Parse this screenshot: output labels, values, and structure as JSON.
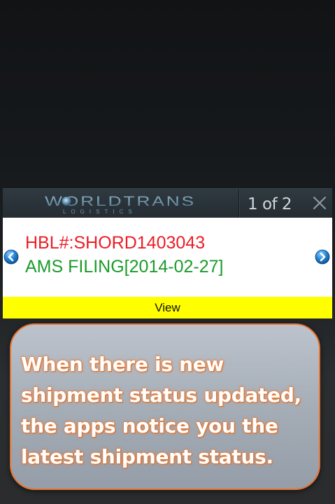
{
  "popup": {
    "logo_text": "WORLDTRANS",
    "logo_subtext": "LOGISTICS",
    "page_indicator": "1 of 2",
    "close_icon": "close-icon",
    "prev_icon": "chevron-left-circle-icon",
    "next_icon": "chevron-right-circle-icon",
    "hbl_text": "HBL#:SHORD1403043",
    "status_text": "AMS FILING[2014-02-27]",
    "view_label": "View"
  },
  "callout": {
    "text": "When there is new\nshipment status updated,\nthe apps notice you the\nlatest shipment status."
  },
  "colors": {
    "hbl_red": "#ec1c24",
    "status_green": "#1a9c2a",
    "view_yellow": "#ffff00",
    "callout_border": "#e8732e"
  }
}
